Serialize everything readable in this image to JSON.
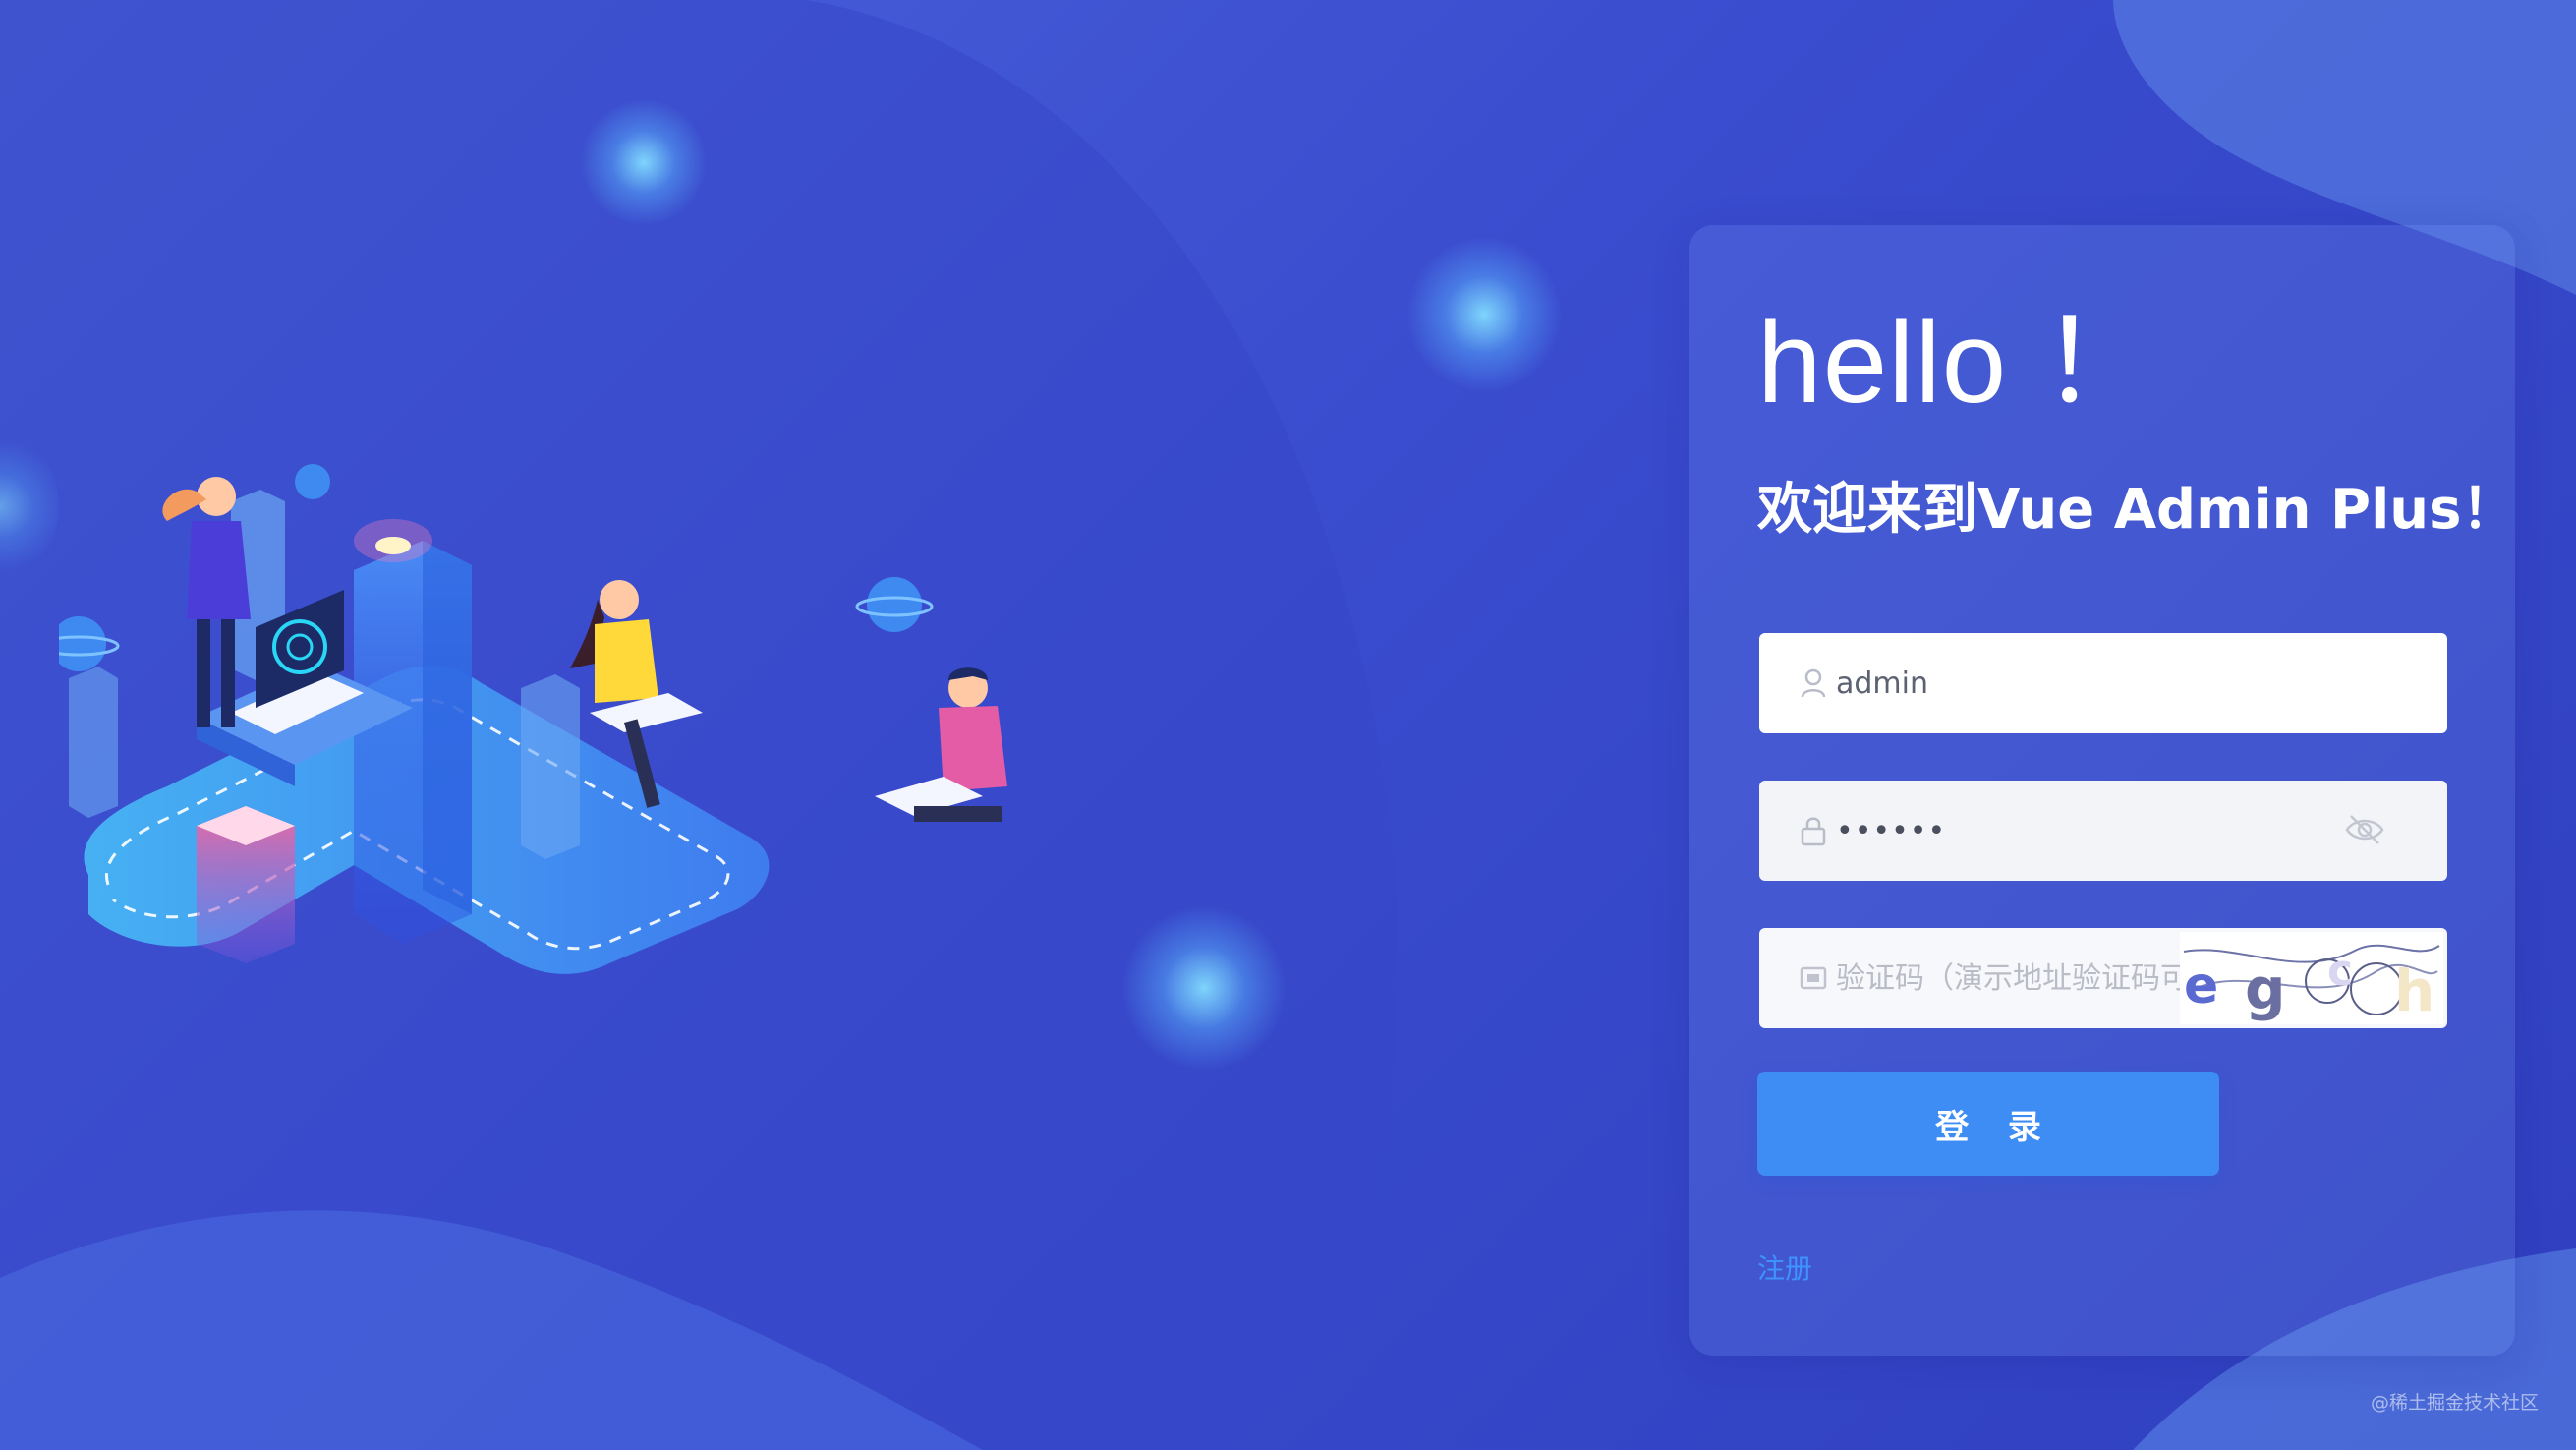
{
  "login": {
    "title": "hello ！",
    "subtitle": "欢迎来到Vue Admin Plus！",
    "username": {
      "value": "admin",
      "icon": "user-icon"
    },
    "password": {
      "mask": "••••••",
      "icon": "lock-icon",
      "toggle_icon": "eye-off-icon"
    },
    "captcha": {
      "placeholder": "验证码（演示地址验证码可不输入）",
      "icon": "captcha-icon",
      "code": "egch"
    },
    "submit_label": "登 录",
    "register_label": "注册"
  },
  "watermark": "@稀土掘金技术社区",
  "colors": {
    "accent": "#3d8df5",
    "link": "#3f93ff",
    "background": "#3a4ccf"
  }
}
